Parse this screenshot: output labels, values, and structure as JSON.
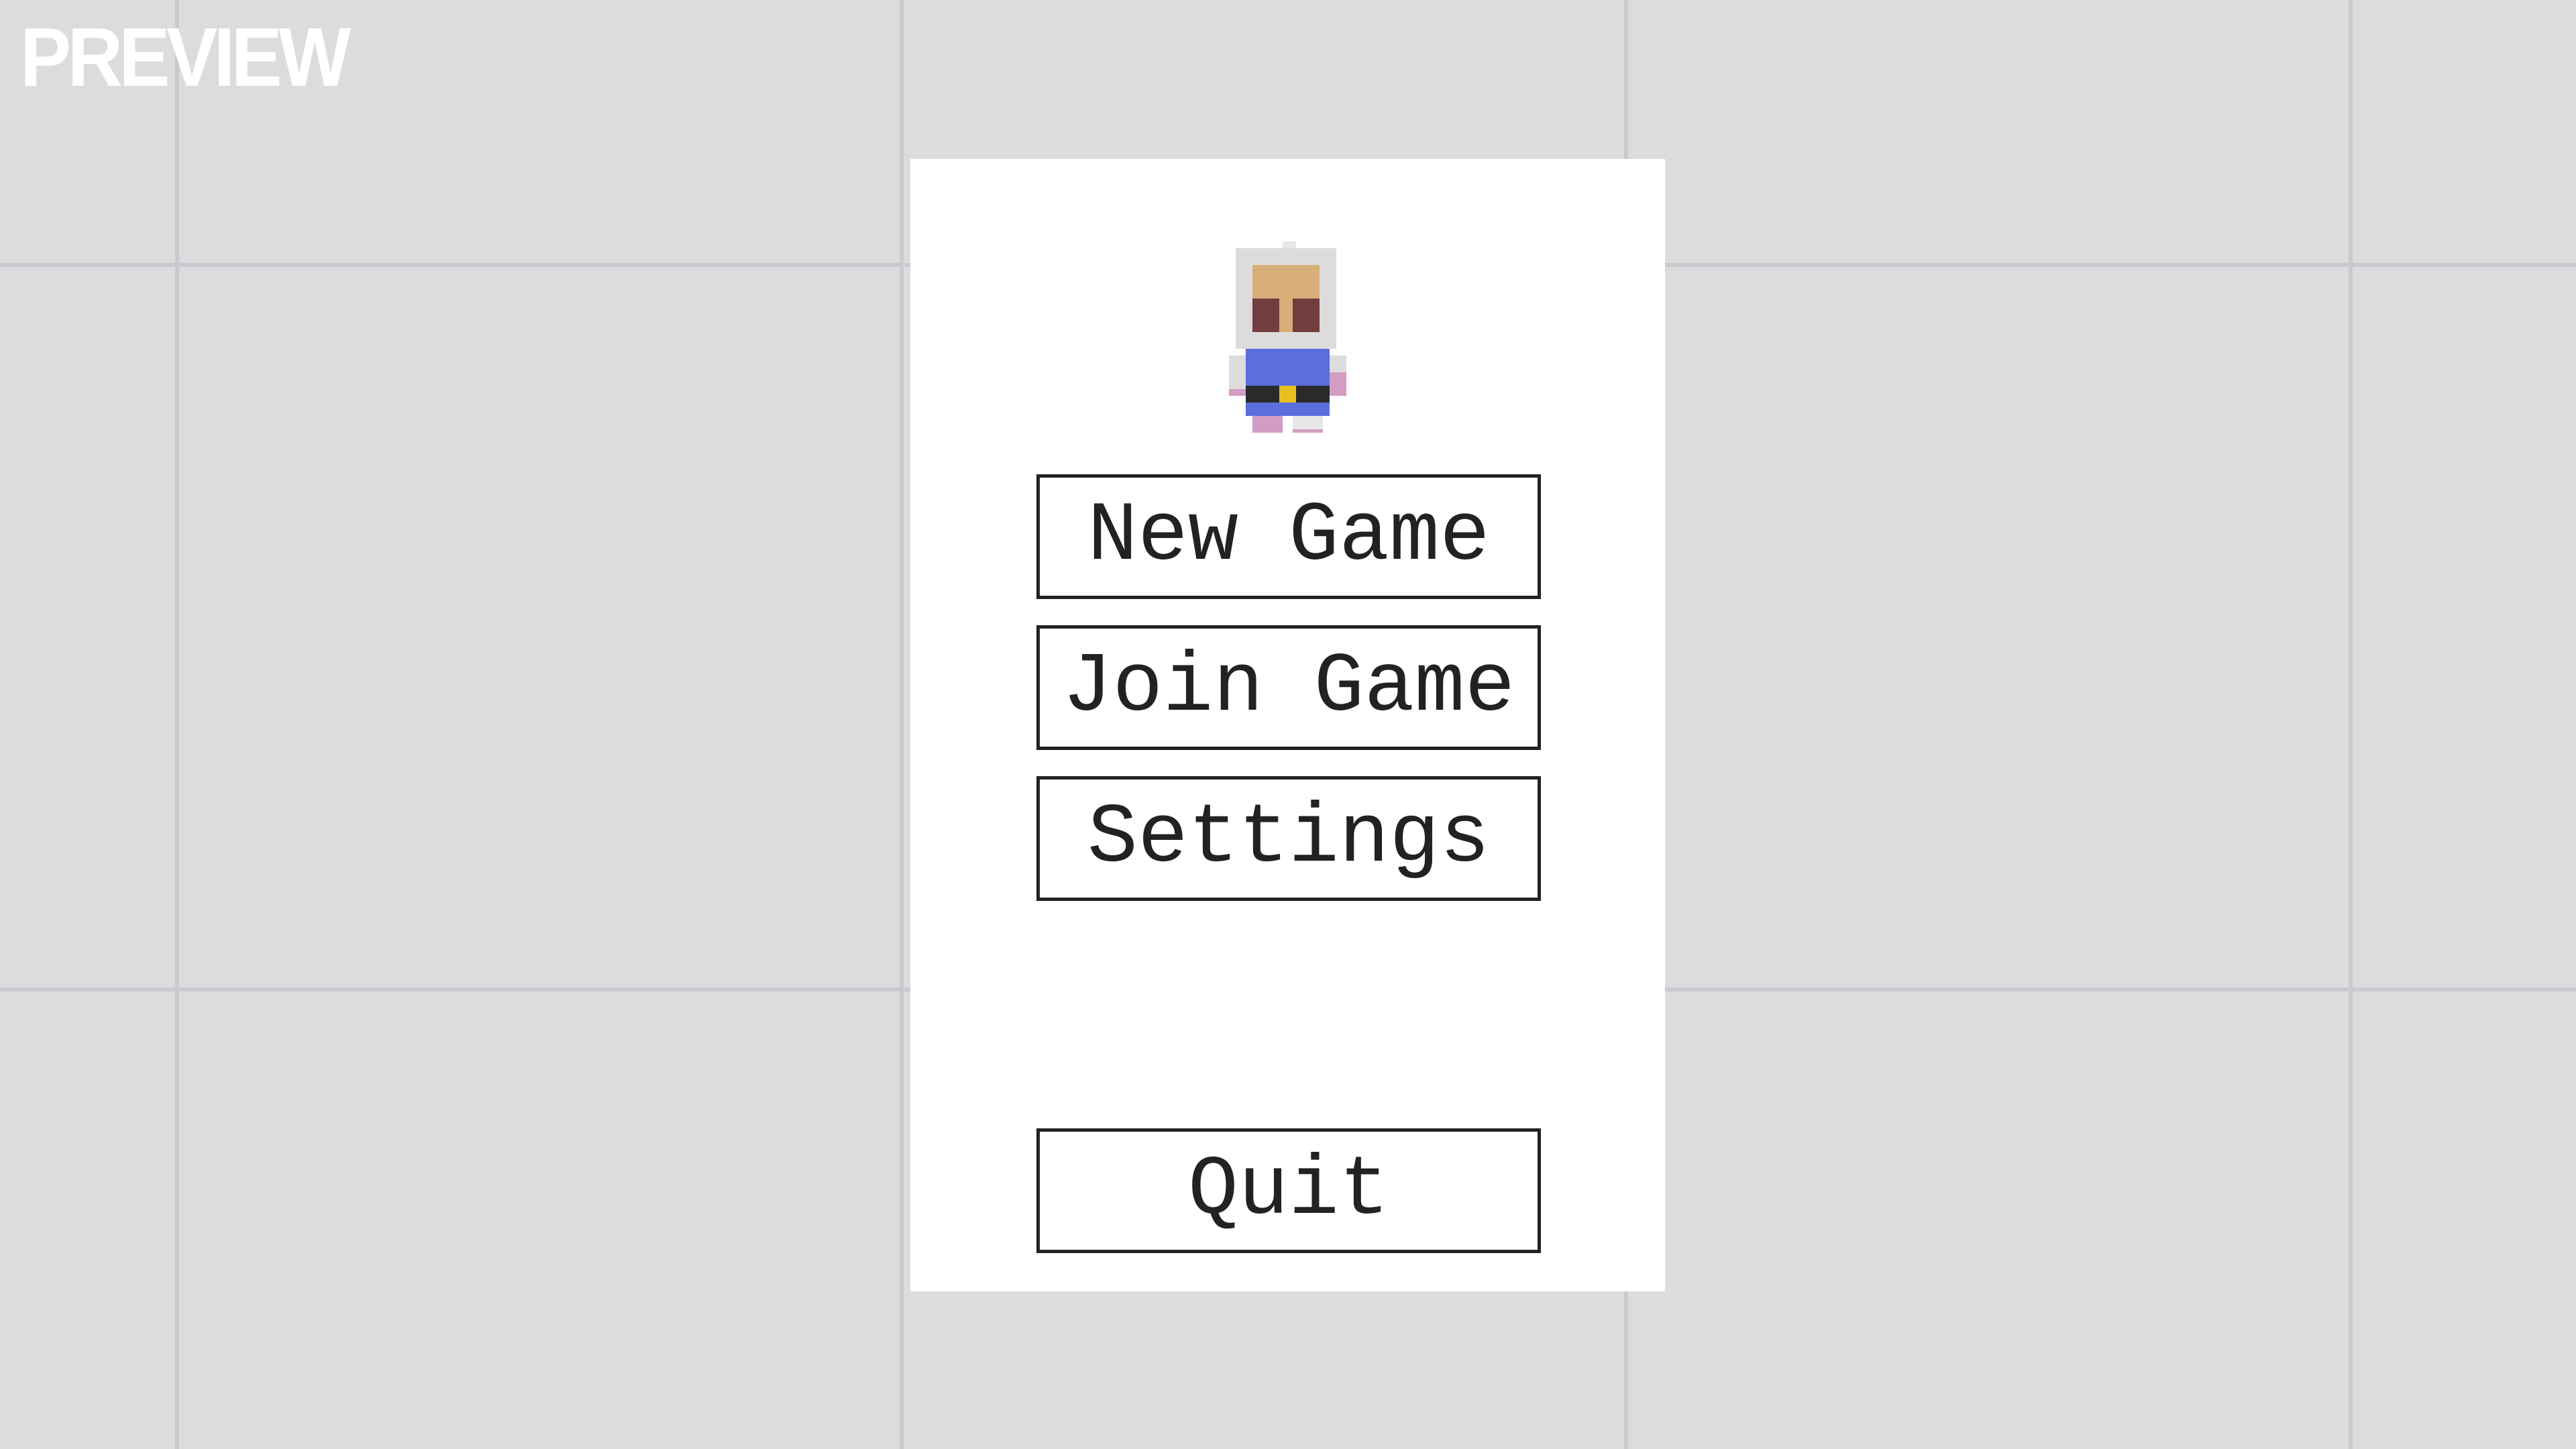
{
  "watermark": "PREVIEW",
  "menu": {
    "new_game": "New Game",
    "join_game": "Join Game",
    "settings": "Settings",
    "quit": "Quit"
  },
  "colors": {
    "background": "#dddbde",
    "grid_line": "#cbc9cd",
    "panel": "#ffffff",
    "button_border": "#222222",
    "button_text": "#222222",
    "avatar_helmet": "#dcdcdc",
    "avatar_face": "#d7ae78",
    "avatar_eyes": "#733d3d",
    "avatar_shirt": "#5a6fdb",
    "avatar_belt": "#2a2a2a",
    "avatar_buckle": "#e8c021",
    "avatar_boots": "#d39cc2"
  }
}
